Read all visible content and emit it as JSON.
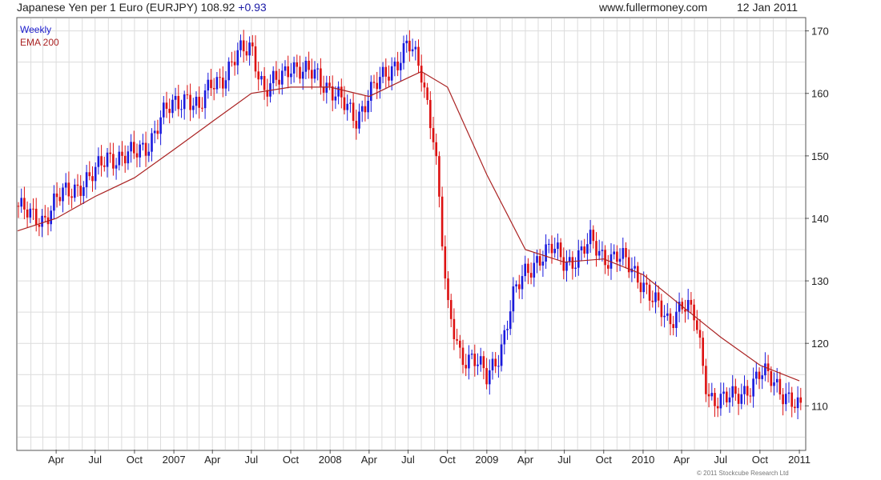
{
  "header": {
    "title": "Japanese Yen per 1 Euro (EURJPY) 108.92",
    "change": "+0.93",
    "site": "www.fullermoney.com",
    "date": "12 Jan 2011"
  },
  "legend": {
    "series1": "Weekly",
    "series2": "EMA 200"
  },
  "credit": "© 2011 Stockcube Research Ltd",
  "colors": {
    "up": "#1a1add",
    "down": "#dd1111",
    "ema": "#aa2222",
    "grid": "#dcdcdc"
  },
  "chart_data": {
    "type": "line",
    "title": "Japanese Yen per 1 Euro (EURJPY)",
    "x_tick_labels": [
      "Apr",
      "Jul",
      "Oct",
      "2007",
      "Apr",
      "Jul",
      "Oct",
      "2008",
      "Apr",
      "Jul",
      "Oct",
      "2009",
      "Apr",
      "Jul",
      "Oct",
      "2010",
      "Apr",
      "Jul",
      "Oct",
      "2011"
    ],
    "y_ticks": [
      110,
      120,
      130,
      140,
      150,
      160,
      170
    ],
    "ylim": [
      103,
      172
    ],
    "grid": true,
    "series": [
      {
        "name": "Weekly",
        "style": "weekly price bars (blue up, red down)",
        "x": [
          "2006-01",
          "2006-02",
          "2006-03",
          "2006-04",
          "2006-05",
          "2006-06",
          "2006-07",
          "2006-08",
          "2006-09",
          "2006-10",
          "2006-11",
          "2006-12",
          "2007-01",
          "2007-02",
          "2007-03",
          "2007-04",
          "2007-05",
          "2007-06",
          "2007-07",
          "2007-08",
          "2007-09",
          "2007-10",
          "2007-11",
          "2007-12",
          "2008-01",
          "2008-02",
          "2008-03",
          "2008-04",
          "2008-05",
          "2008-06",
          "2008-07",
          "2008-08",
          "2008-09",
          "2008-10",
          "2008-11",
          "2008-12",
          "2009-01",
          "2009-02",
          "2009-03",
          "2009-04",
          "2009-05",
          "2009-06",
          "2009-07",
          "2009-08",
          "2009-09",
          "2009-10",
          "2009-11",
          "2009-12",
          "2010-01",
          "2010-02",
          "2010-03",
          "2010-04",
          "2010-05",
          "2010-06",
          "2010-07",
          "2010-08",
          "2010-09",
          "2010-10",
          "2010-11",
          "2010-12",
          "2011-01"
        ],
        "y": [
          142,
          140,
          140,
          143,
          144,
          146,
          147,
          150,
          150,
          150,
          152,
          156,
          158,
          160,
          157,
          162,
          163,
          166,
          168,
          160,
          162,
          165,
          163,
          163,
          161,
          158,
          156,
          160,
          162,
          165,
          168,
          163,
          153,
          125,
          118,
          118,
          114,
          119,
          127,
          131,
          134,
          135,
          133,
          134,
          136,
          134,
          134,
          132,
          130,
          126,
          123,
          127,
          124,
          112,
          111,
          111,
          113,
          115,
          114,
          112,
          109
        ]
      },
      {
        "name": "EMA 200",
        "x": [
          "2006-01",
          "2006-04",
          "2006-07",
          "2006-10",
          "2007-01",
          "2007-04",
          "2007-07",
          "2007-10",
          "2008-01",
          "2008-04",
          "2008-07",
          "2008-08",
          "2008-10",
          "2009-01",
          "2009-04",
          "2009-07",
          "2009-10",
          "2010-01",
          "2010-04",
          "2010-07",
          "2010-10",
          "2011-01"
        ],
        "y": [
          138,
          140,
          143.5,
          146.5,
          151,
          155.5,
          160,
          161,
          161,
          159.5,
          162.5,
          163.5,
          161,
          147,
          135,
          133,
          133.5,
          131,
          126,
          121,
          116.5,
          114
        ]
      }
    ]
  }
}
